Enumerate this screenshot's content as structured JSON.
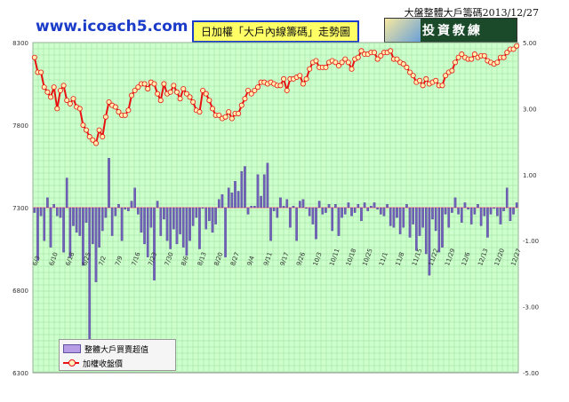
{
  "site_url": "www.icoach5.com",
  "header_title": "大盤整體大戶籌碼2013/12/27",
  "chart_heading": "日加權「大戶內線籌碼」走勢圖",
  "brand_logo_text": "投資教練",
  "colors": {
    "plot_bg": "#ccffcc",
    "grid": "#9fd99f",
    "bar": "#7060b8",
    "line": "#e81010",
    "marker_fill": "#fff0b0",
    "zero_line": "#ff9f9f"
  },
  "chart_data": {
    "type": "bar+line",
    "legend_position": "bottom-left",
    "grid": true,
    "left_axis": {
      "min": 6300,
      "max": 8300,
      "ticks": [
        6300,
        6800,
        7300,
        7800,
        8300
      ]
    },
    "right_axis": {
      "min": -5.0,
      "max": 5.0,
      "tick_labels": [
        "5.00",
        "3.00",
        "1.00",
        "-1.00",
        "-3.00",
        "-5.00"
      ],
      "tick_values": [
        5,
        3,
        1,
        -1,
        -3,
        -5
      ]
    },
    "x_tick_labels": [
      "6/3",
      "6/10",
      "6/18",
      "6/25",
      "7/2",
      "7/9",
      "7/16",
      "7/23",
      "7/30",
      "8/6",
      "8/13",
      "8/20",
      "8/27",
      "9/4",
      "9/11",
      "9/17",
      "9/26",
      "10/3",
      "10/11",
      "10/18",
      "10/25",
      "11/1",
      "11/8",
      "11/15",
      "11/22",
      "11/29",
      "12/6",
      "12/13",
      "12/20",
      "12/27"
    ],
    "series": [
      {
        "name": "整體大戶買賣超值",
        "kind": "bar",
        "axis": "left",
        "baseline": 7300,
        "values": [
          7270,
          6980,
          7250,
          7100,
          7360,
          7060,
          7320,
          7250,
          7240,
          7030,
          7480,
          7000,
          7190,
          7150,
          7130,
          6950,
          7210,
          6420,
          7080,
          6850,
          7060,
          7160,
          7240,
          7600,
          7130,
          7250,
          7320,
          7100,
          7290,
          7280,
          7340,
          7420,
          7260,
          7150,
          7080,
          7000,
          7180,
          6860,
          7340,
          7130,
          7230,
          7100,
          7050,
          7170,
          7080,
          7140,
          7060,
          7010,
          7100,
          7190,
          7240,
          7050,
          7300,
          7170,
          7220,
          7150,
          7200,
          7350,
          7380,
          7000,
          7420,
          7390,
          7460,
          7400,
          7520,
          7550,
          7260,
          7310,
          7310,
          7500,
          7370,
          7500,
          7570,
          7100,
          7280,
          7240,
          7360,
          7310,
          7350,
          7180,
          7310,
          7100,
          7340,
          7350,
          7300,
          7250,
          7200,
          7110,
          7340,
          7260,
          7270,
          7320,
          7160,
          7320,
          7130,
          7240,
          7260,
          7330,
          7250,
          7270,
          7320,
          7220,
          7330,
          7280,
          7310,
          7330,
          7290,
          7260,
          7250,
          7320,
          7190,
          7180,
          7240,
          7140,
          7180,
          7320,
          7120,
          7200,
          7040,
          7130,
          7180,
          7020,
          6890,
          7230,
          7160,
          7030,
          7060,
          7260,
          7180,
          7270,
          7360,
          7260,
          7210,
          7330,
          7290,
          7200,
          7260,
          7320,
          7190,
          7250,
          7120,
          7260,
          7300,
          7250,
          7200,
          7280,
          7420,
          7220,
          7260,
          7330
        ]
      },
      {
        "name": "加權收盤價",
        "kind": "line",
        "axis": "left",
        "values": [
          8210,
          8120,
          8120,
          8030,
          8000,
          7970,
          8030,
          7900,
          8010,
          8040,
          7950,
          7930,
          7960,
          7910,
          7900,
          7800,
          7770,
          7730,
          7710,
          7690,
          7770,
          7730,
          7850,
          7940,
          7920,
          7910,
          7880,
          7860,
          7860,
          7890,
          7980,
          8010,
          8030,
          8050,
          8050,
          8020,
          8060,
          8050,
          7990,
          7950,
          8050,
          7990,
          8000,
          8040,
          8000,
          7960,
          8020,
          7990,
          7970,
          7940,
          7890,
          7880,
          8010,
          7990,
          7950,
          7900,
          7860,
          7860,
          7840,
          7850,
          7880,
          7840,
          7870,
          7870,
          7920,
          7960,
          8010,
          7990,
          8010,
          8030,
          8060,
          8060,
          8050,
          8060,
          8050,
          8040,
          8040,
          8080,
          8010,
          8080,
          8080,
          8090,
          8100,
          8050,
          8080,
          8140,
          8180,
          8190,
          8150,
          8150,
          8150,
          8180,
          8190,
          8180,
          8160,
          8180,
          8200,
          8180,
          8140,
          8200,
          8210,
          8250,
          8230,
          8230,
          8240,
          8240,
          8200,
          8220,
          8240,
          8240,
          8250,
          8200,
          8200,
          8180,
          8170,
          8150,
          8120,
          8100,
          8060,
          8070,
          8040,
          8080,
          8050,
          8060,
          8070,
          8040,
          8040,
          8100,
          8120,
          8130,
          8180,
          8210,
          8230,
          8210,
          8200,
          8200,
          8230,
          8210,
          8220,
          8220,
          8190,
          8180,
          8170,
          8180,
          8210,
          8210,
          8240,
          8260,
          8260,
          8280
        ]
      }
    ]
  }
}
